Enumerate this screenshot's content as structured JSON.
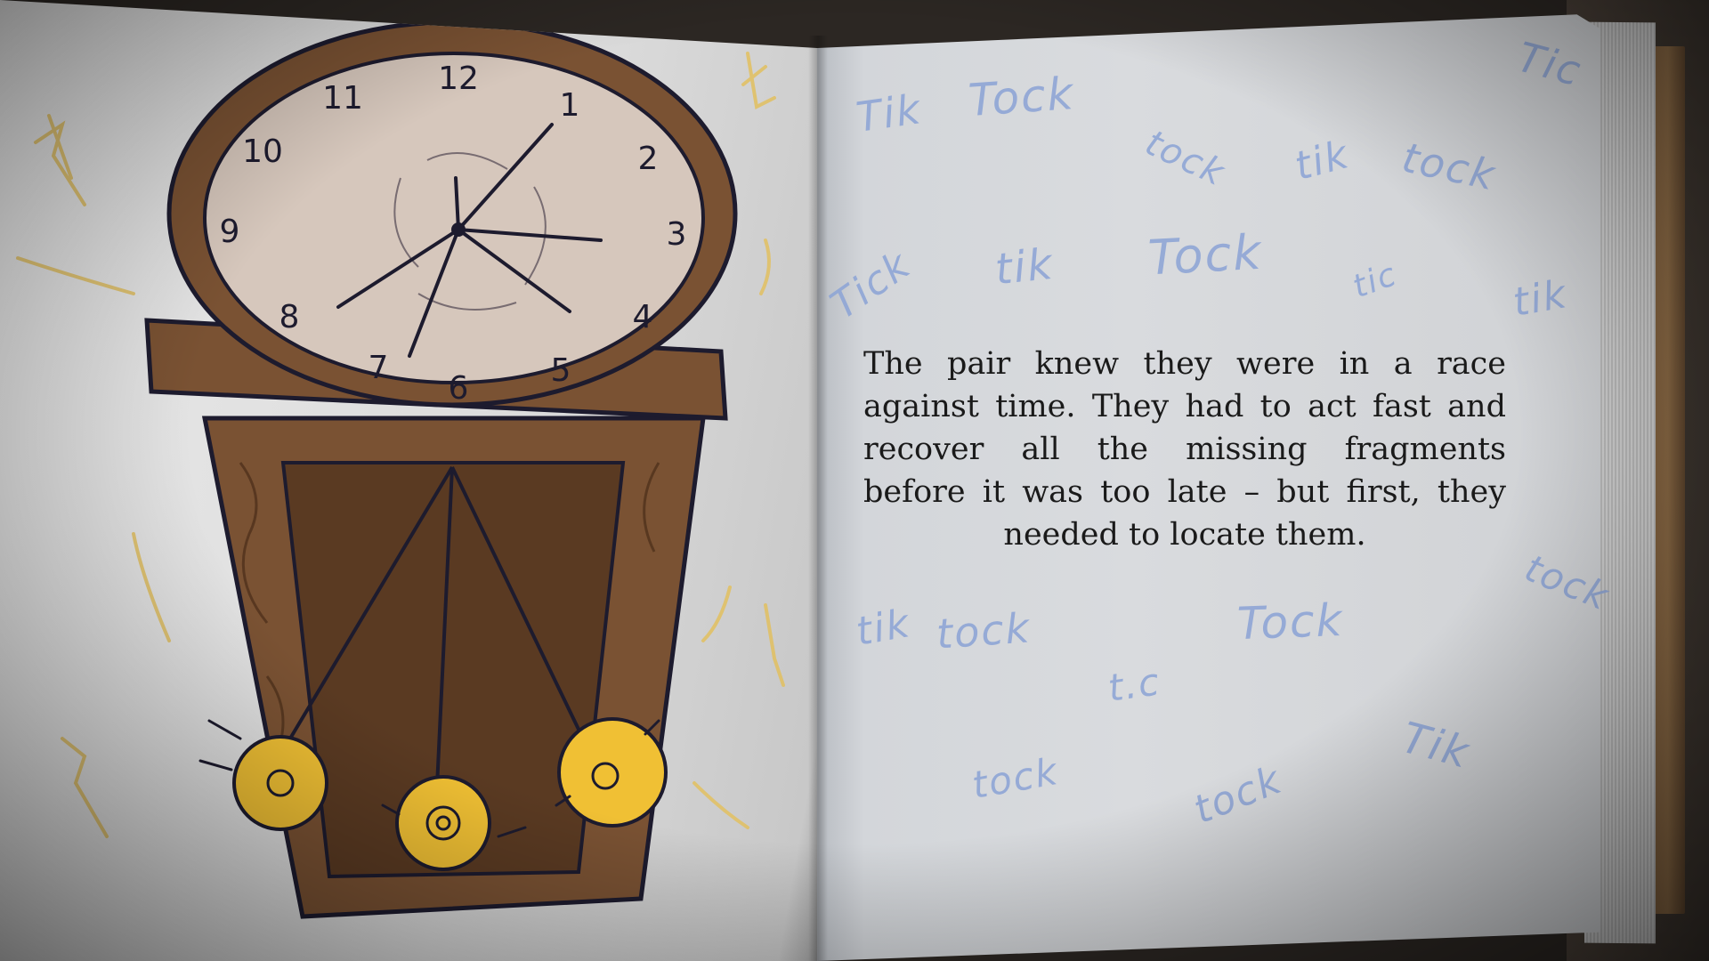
{
  "story": {
    "text": "The pair knew they were in a race against time. They had to act fast and recover all the missing fragments before it was too late – but first, they needed to locate them."
  },
  "clock_numerals": [
    "12",
    "1",
    "2",
    "3",
    "4",
    "5",
    "6",
    "7",
    "8",
    "9",
    "10",
    "11"
  ],
  "doodles": [
    "Tik",
    "Tock",
    "Tic",
    "tock",
    "tik",
    "tock",
    "Tick",
    "tik",
    "Tock",
    "tic",
    "tik",
    "tock",
    "tik",
    "tock",
    "Tock",
    "t.c",
    "tock",
    "tock",
    "Tik"
  ],
  "colors": {
    "doodle_blue": "#8fa6d6",
    "wood": "#7a5233",
    "wood_dark": "#5a3a22",
    "clock_face": "#d6c7bc",
    "brass": "#f0c034",
    "ink": "#1d1b2e"
  }
}
